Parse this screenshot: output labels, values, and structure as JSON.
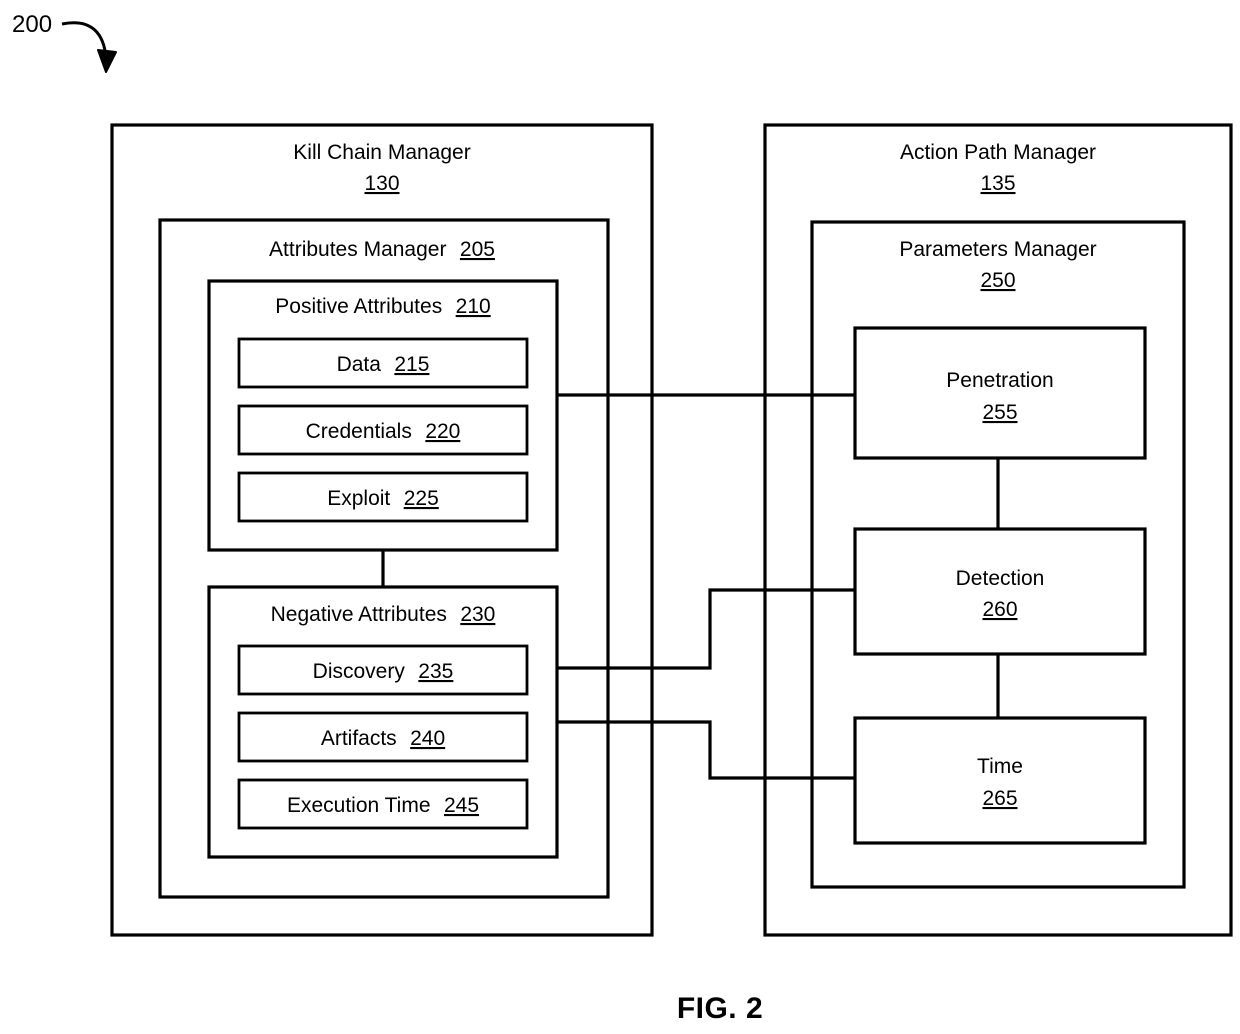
{
  "figure": {
    "number_label": "200",
    "caption": "FIG. 2"
  },
  "panels": [
    {
      "id": "kill-chain-manager",
      "title": "Kill Chain Manager",
      "ref": "130",
      "title_layout": "two-line",
      "children": [
        {
          "id": "attributes-manager",
          "title": "Attributes Manager",
          "ref": "205",
          "title_layout": "inline",
          "children": [
            {
              "id": "positive-attributes",
              "title": "Positive Attributes",
              "ref": "210",
              "title_layout": "inline",
              "children": [
                {
                  "id": "data",
                  "title": "Data",
                  "ref": "215",
                  "title_layout": "inline"
                },
                {
                  "id": "credentials",
                  "title": "Credentials",
                  "ref": "220",
                  "title_layout": "inline"
                },
                {
                  "id": "exploit",
                  "title": "Exploit",
                  "ref": "225",
                  "title_layout": "inline"
                }
              ]
            },
            {
              "id": "negative-attributes",
              "title": "Negative Attributes",
              "ref": "230",
              "title_layout": "inline",
              "children": [
                {
                  "id": "discovery",
                  "title": "Discovery",
                  "ref": "235",
                  "title_layout": "inline"
                },
                {
                  "id": "artifacts",
                  "title": "Artifacts",
                  "ref": "240",
                  "title_layout": "inline"
                },
                {
                  "id": "execution-time",
                  "title": "Execution Time",
                  "ref": "245",
                  "title_layout": "inline"
                }
              ]
            }
          ]
        }
      ]
    },
    {
      "id": "action-path-manager",
      "title": "Action Path Manager",
      "ref": "135",
      "title_layout": "two-line",
      "children": [
        {
          "id": "parameters-manager",
          "title": "Parameters Manager",
          "ref": "250",
          "title_layout": "two-line",
          "children": [
            {
              "id": "penetration",
              "title": "Penetration",
              "ref": "255",
              "title_layout": "two-line"
            },
            {
              "id": "detection",
              "title": "Detection",
              "ref": "260",
              "title_layout": "two-line"
            },
            {
              "id": "time",
              "title": "Time",
              "ref": "265",
              "title_layout": "two-line"
            }
          ]
        }
      ]
    }
  ],
  "connections": [
    {
      "id": "positive-to-negative",
      "from": "positive-attributes",
      "to": "negative-attributes"
    },
    {
      "id": "positive-to-penetration",
      "from": "positive-attributes",
      "to": "penetration"
    },
    {
      "id": "discovery-to-detection",
      "from": "discovery",
      "to": "detection"
    },
    {
      "id": "artifacts-to-time",
      "from": "artifacts",
      "to": "time"
    },
    {
      "id": "penetration-to-detection",
      "from": "penetration",
      "to": "detection"
    },
    {
      "id": "detection-to-time",
      "from": "detection",
      "to": "time"
    }
  ],
  "colors": {
    "stroke": "#000000",
    "fill": "#ffffff",
    "text": "#000000"
  }
}
